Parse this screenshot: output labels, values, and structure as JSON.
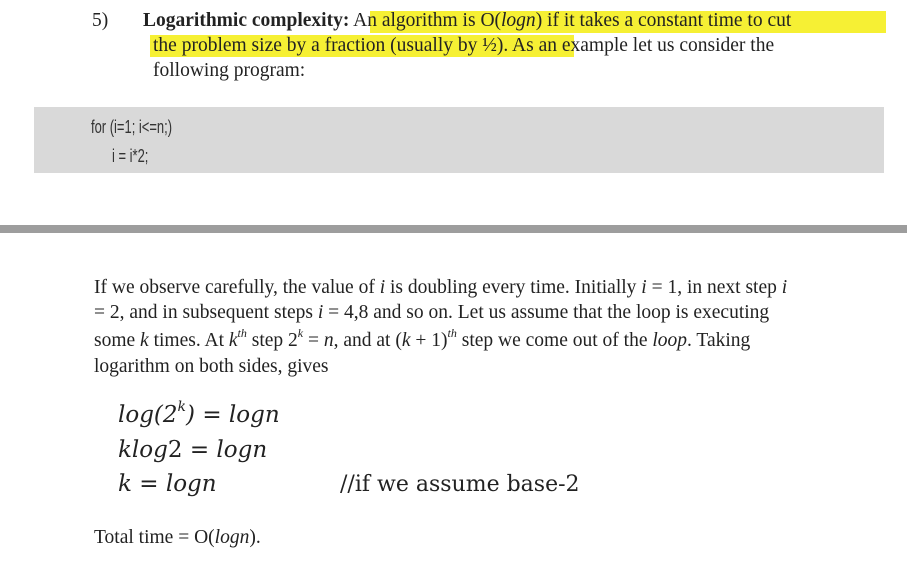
{
  "item": {
    "number": "5)",
    "term": "Logarithmic complexity:",
    "line1_rest": "An algorithm is O(logn) if it takes a constant time to cut",
    "line2": "the problem size by a fraction (usually by ½). As an example let us consider the",
    "line3": "following program:"
  },
  "code": {
    "line1": "for (i=1; i<=n;)",
    "line2": "i = i*2;"
  },
  "paragraph": {
    "line1": "If we observe carefully, the value of i is doubling every time. Initially i = 1, in next step i",
    "line2": "= 2, and in subsequent steps i = 4,8 and so on. Let us assume that the loop is executing",
    "line3": "some k times. At kth step 2k = n, and at (k + 1)th step we come out of the loop. Taking",
    "line4": "logarithm on both sides, gives"
  },
  "equations": {
    "eq1": "log(2k) = logn",
    "eq2": "klog2 = logn",
    "eq3": "k = logn",
    "comment": "//if we assume base-2"
  },
  "total": "Total time = O(logn).",
  "colors": {
    "highlight": "#f6f034",
    "code_bg": "#d9d9d9",
    "rule": "#9d9d9d"
  }
}
